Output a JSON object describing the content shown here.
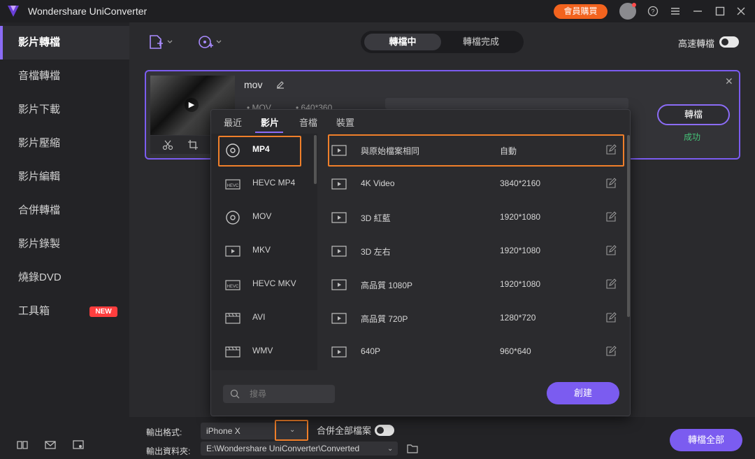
{
  "window": {
    "app_title": "Wondershare UniConverter",
    "buy_label": "會員購買",
    "icons": [
      "help-icon",
      "menu-icon",
      "minimize-icon",
      "maximize-icon",
      "close-icon"
    ]
  },
  "sidebar": {
    "items": [
      {
        "label": "影片轉檔",
        "active": true
      },
      {
        "label": "音檔轉檔"
      },
      {
        "label": "影片下載"
      },
      {
        "label": "影片壓縮"
      },
      {
        "label": "影片編輯"
      },
      {
        "label": "合併轉檔"
      },
      {
        "label": "影片錄製"
      },
      {
        "label": "燒錄DVD"
      },
      {
        "label": "工具箱",
        "badge": "NEW"
      }
    ]
  },
  "toolbar": {
    "tabs": [
      "轉檔中",
      "轉檔完成"
    ],
    "active_tab": "轉檔中",
    "high_speed_label": "高速轉檔"
  },
  "file_card": {
    "name": "mov",
    "format": "MOV",
    "resolution": "640*360",
    "convert_label": "轉檔",
    "status": "成功"
  },
  "format_popup": {
    "tabs": [
      "最近",
      "影片",
      "音檔",
      "裝置"
    ],
    "active_tab": "影片",
    "formats": [
      "MP4",
      "HEVC MP4",
      "MOV",
      "MKV",
      "HEVC MKV",
      "AVI",
      "WMV"
    ],
    "selected_format": "MP4",
    "presets": [
      {
        "name": "與原始檔案相同",
        "resolution": "自動"
      },
      {
        "name": "4K Video",
        "resolution": "3840*2160"
      },
      {
        "name": "3D 紅藍",
        "resolution": "1920*1080"
      },
      {
        "name": "3D 左右",
        "resolution": "1920*1080"
      },
      {
        "name": "高品質 1080P",
        "resolution": "1920*1080"
      },
      {
        "name": "高品質 720P",
        "resolution": "1280*720"
      },
      {
        "name": "640P",
        "resolution": "960*640"
      }
    ],
    "search_placeholder": "搜尋",
    "create_label": "創建"
  },
  "bottom": {
    "output_format_label": "輸出格式:",
    "output_format_value": "iPhone X",
    "merge_label": "合併全部檔案",
    "output_folder_label": "輸出資料夾:",
    "output_folder_value": "E:\\Wondershare UniConverter\\Converted",
    "convert_all_label": "轉檔全部"
  },
  "colors": {
    "accent": "#7b5cf0",
    "highlight": "#f07f2a",
    "success": "#45c277",
    "buy": "#f2631e"
  }
}
